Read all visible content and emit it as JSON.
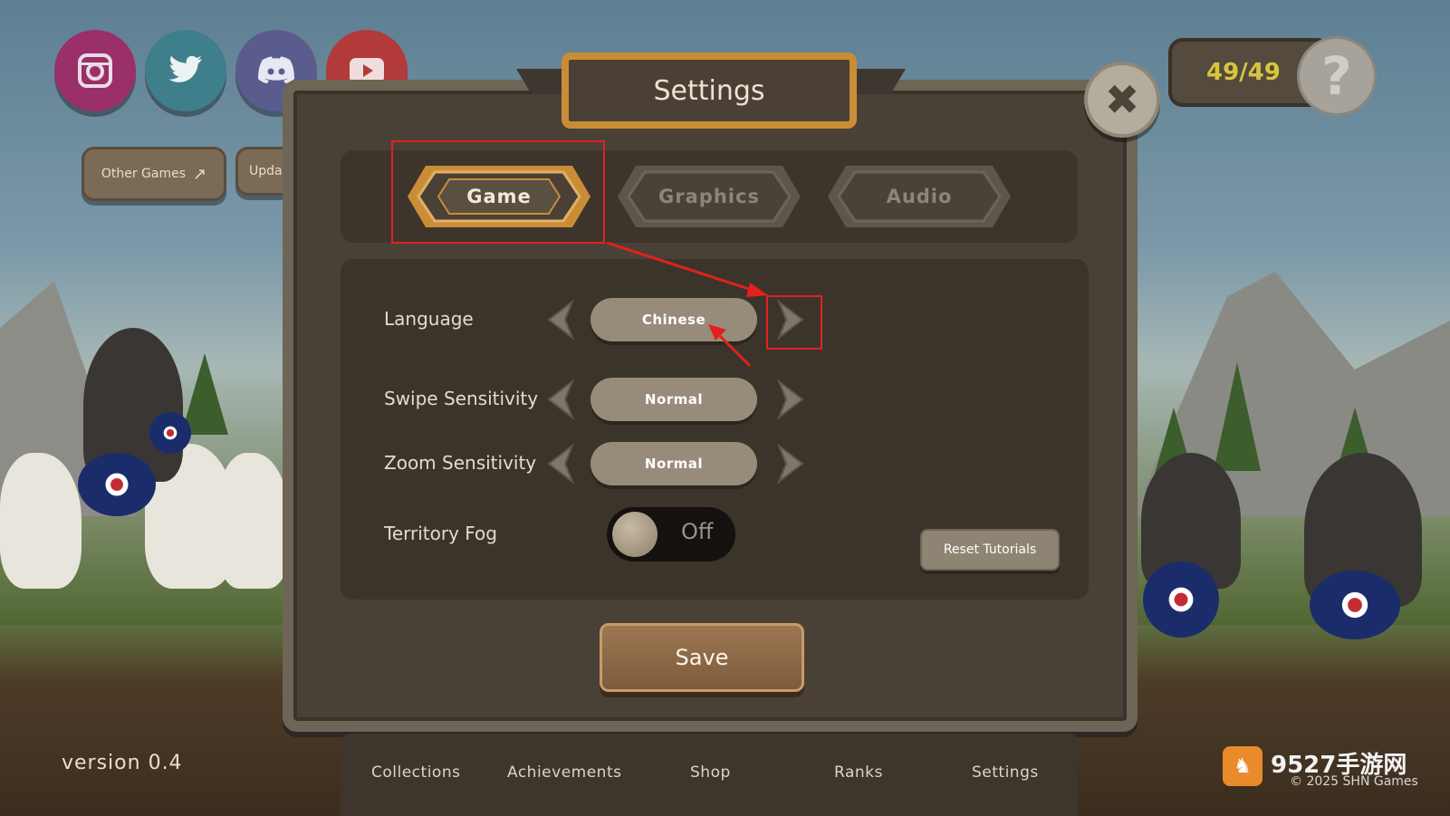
{
  "social": {
    "instagram_color": "#9a2f6a",
    "twitter_color": "#3f7e8b",
    "discord_color": "#5b5c8e",
    "youtube_color": "#b23a3a"
  },
  "side_buttons": {
    "other_games": "Other Games",
    "updates_partial": "Upda"
  },
  "counter": {
    "value": "49/49",
    "help_glyph": "?"
  },
  "dialog": {
    "title": "Settings",
    "close_glyph": "✖",
    "tabs": [
      {
        "label": "Game",
        "active": true
      },
      {
        "label": "Graphics",
        "active": false
      },
      {
        "label": "Audio",
        "active": false
      }
    ],
    "rows": [
      {
        "label": "Language",
        "value": "Chinese"
      },
      {
        "label": "Swipe Sensitivity",
        "value": "Normal"
      },
      {
        "label": "Zoom Sensitivity",
        "value": "Normal"
      }
    ],
    "fog": {
      "label": "Territory Fog",
      "state": "Off"
    },
    "reset_label": "Reset Tutorials",
    "save_label": "Save"
  },
  "bottom_nav": [
    "Collections",
    "Achievements",
    "Shop",
    "Ranks",
    "Settings"
  ],
  "version": "version 0.4",
  "watermark": {
    "site": "9527手游网",
    "copyright": "© 2025 SHN Games"
  },
  "colors": {
    "accent_gold": "#c98d36",
    "annotation_red": "#e3201f",
    "counter_yellow": "#d8c53e"
  }
}
